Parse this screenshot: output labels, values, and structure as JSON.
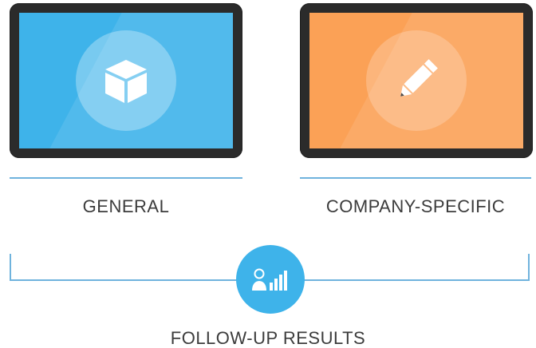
{
  "cards": [
    {
      "label": "GENERAL",
      "screen_color": "#3eb3ea",
      "icon": "cube-icon"
    },
    {
      "label": "COMPANY-SPECIFIC",
      "screen_color": "#fba156",
      "icon": "pencil-icon"
    }
  ],
  "results": {
    "label": "FOLLOW-UP RESULTS",
    "icon": "user-chart-icon",
    "color": "#3eb3ea"
  },
  "colors": {
    "rule": "#6fb3dd",
    "bezel": "#2b2b2b",
    "text": "#3c3c3c"
  }
}
